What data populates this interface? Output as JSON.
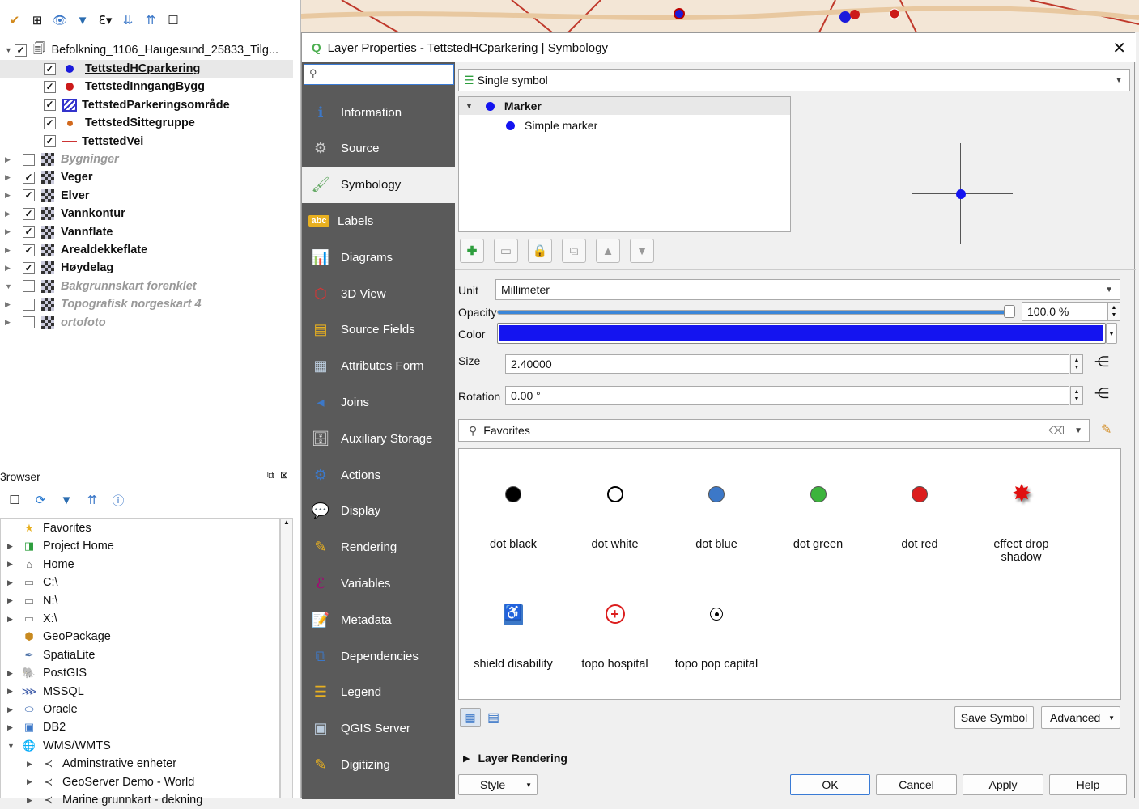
{
  "layers_panel": {
    "group": "Befolkning_1106_Haugesund_25833_Tilg...",
    "items": [
      {
        "label": "TettstedHCparkering",
        "checked": true,
        "color": "#1a1adb",
        "kind": "dot"
      },
      {
        "label": "TettstedInngangBygg",
        "checked": true,
        "color": "#cc1a1a",
        "kind": "dot"
      },
      {
        "label": "TettstedParkeringsområde",
        "checked": true,
        "color": "#3333cc",
        "kind": "hatch"
      },
      {
        "label": "TettstedSittegruppe",
        "checked": true,
        "color": "#d2691e",
        "kind": "smalldot"
      },
      {
        "label": "TettstedVei",
        "checked": true,
        "color": "#cc3333",
        "kind": "line"
      }
    ],
    "raster_layers": [
      {
        "label": "Bygninger",
        "checked": false
      },
      {
        "label": "Veger",
        "checked": true
      },
      {
        "label": "Elver",
        "checked": true
      },
      {
        "label": "Vannkontur",
        "checked": true
      },
      {
        "label": "Vannflate",
        "checked": true
      },
      {
        "label": "Arealdekkeflate",
        "checked": true
      },
      {
        "label": "Høydelag",
        "checked": true
      },
      {
        "label": "Bakgrunnskart forenklet",
        "checked": false
      },
      {
        "label": "Topografisk norgeskart 4",
        "checked": false
      },
      {
        "label": "ortofoto",
        "checked": false
      }
    ]
  },
  "browser": {
    "title": "3rowser",
    "items": [
      {
        "label": "Favorites",
        "icon": "star-icon"
      },
      {
        "label": "Project Home",
        "icon": "project-home-icon"
      },
      {
        "label": "Home",
        "icon": "home-icon"
      },
      {
        "label": "C:\\",
        "icon": "folder-icon"
      },
      {
        "label": "N:\\",
        "icon": "folder-icon"
      },
      {
        "label": "X:\\",
        "icon": "folder-icon"
      },
      {
        "label": "GeoPackage",
        "icon": "geopackage-icon"
      },
      {
        "label": "SpatiaLite",
        "icon": "spatialite-icon"
      },
      {
        "label": "PostGIS",
        "icon": "postgis-icon"
      },
      {
        "label": "MSSQL",
        "icon": "mssql-icon"
      },
      {
        "label": "Oracle",
        "icon": "oracle-icon"
      },
      {
        "label": "DB2",
        "icon": "db2-icon"
      },
      {
        "label": "WMS/WMTS",
        "icon": "wms-icon"
      },
      {
        "label": "Adminstrative enheter",
        "icon": "wms-layer-icon"
      },
      {
        "label": "GeoServer Demo - World",
        "icon": "wms-layer-icon"
      },
      {
        "label": "Marine grunnkart - dekning",
        "icon": "wms-layer-icon"
      }
    ]
  },
  "dialog": {
    "title": "Layer Properties - TettstedHCparkering | Symbology",
    "nav": [
      {
        "label": "Information",
        "icon": "information-icon"
      },
      {
        "label": "Source",
        "icon": "source-icon"
      },
      {
        "label": "Symbology",
        "icon": "symbology-icon"
      },
      {
        "label": "Labels",
        "icon": "labels-icon"
      },
      {
        "label": "Diagrams",
        "icon": "diagrams-icon"
      },
      {
        "label": "3D View",
        "icon": "3d-view-icon"
      },
      {
        "label": "Source Fields",
        "icon": "source-fields-icon"
      },
      {
        "label": "Attributes Form",
        "icon": "attributes-form-icon"
      },
      {
        "label": "Joins",
        "icon": "joins-icon"
      },
      {
        "label": "Auxiliary Storage",
        "icon": "auxiliary-storage-icon"
      },
      {
        "label": "Actions",
        "icon": "actions-icon"
      },
      {
        "label": "Display",
        "icon": "display-icon"
      },
      {
        "label": "Rendering",
        "icon": "rendering-icon"
      },
      {
        "label": "Variables",
        "icon": "variables-icon"
      },
      {
        "label": "Metadata",
        "icon": "metadata-icon"
      },
      {
        "label": "Dependencies",
        "icon": "dependencies-icon"
      },
      {
        "label": "Legend",
        "icon": "legend-icon"
      },
      {
        "label": "QGIS Server",
        "icon": "qgis-server-icon"
      },
      {
        "label": "Digitizing",
        "icon": "digitizing-icon"
      }
    ],
    "renderer": "Single symbol",
    "tree": {
      "root": "Marker",
      "child": "Simple marker"
    },
    "unit_label": "Unit",
    "unit_value": "Millimeter",
    "opacity_label": "Opacity",
    "opacity_value": "100.0 %",
    "opacity_fraction": 1.0,
    "color_label": "Color",
    "color_value": "#1414f0",
    "size_label": "Size",
    "size_value": "2.40000",
    "rotation_label": "Rotation",
    "rotation_value": "0.00 °",
    "favorites": "Favorites",
    "symbols": [
      {
        "label": "dot  black",
        "kind": "dot",
        "color": "#000000"
      },
      {
        "label": "dot  white",
        "kind": "ring",
        "color": "#ffffff"
      },
      {
        "label": "dot blue",
        "kind": "dot",
        "color": "#3c78c8"
      },
      {
        "label": "dot green",
        "kind": "dot",
        "color": "#3cb43c"
      },
      {
        "label": "dot red",
        "kind": "dot",
        "color": "#dc1e1e"
      },
      {
        "label": "effect drop\nshadow",
        "kind": "star",
        "color": "#e01010"
      },
      {
        "label": "shield disability",
        "kind": "disability",
        "color": "#3c78c8"
      },
      {
        "label": "topo hospital",
        "kind": "hospital",
        "color": "#dc1e1e"
      },
      {
        "label": "topo pop capital",
        "kind": "capital",
        "color": "#000000"
      }
    ],
    "save_symbol": "Save Symbol",
    "advanced": "Advanced",
    "layer_rendering": "Layer Rendering",
    "style": "Style",
    "ok": "OK",
    "cancel": "Cancel",
    "apply": "Apply",
    "help": "Help"
  }
}
